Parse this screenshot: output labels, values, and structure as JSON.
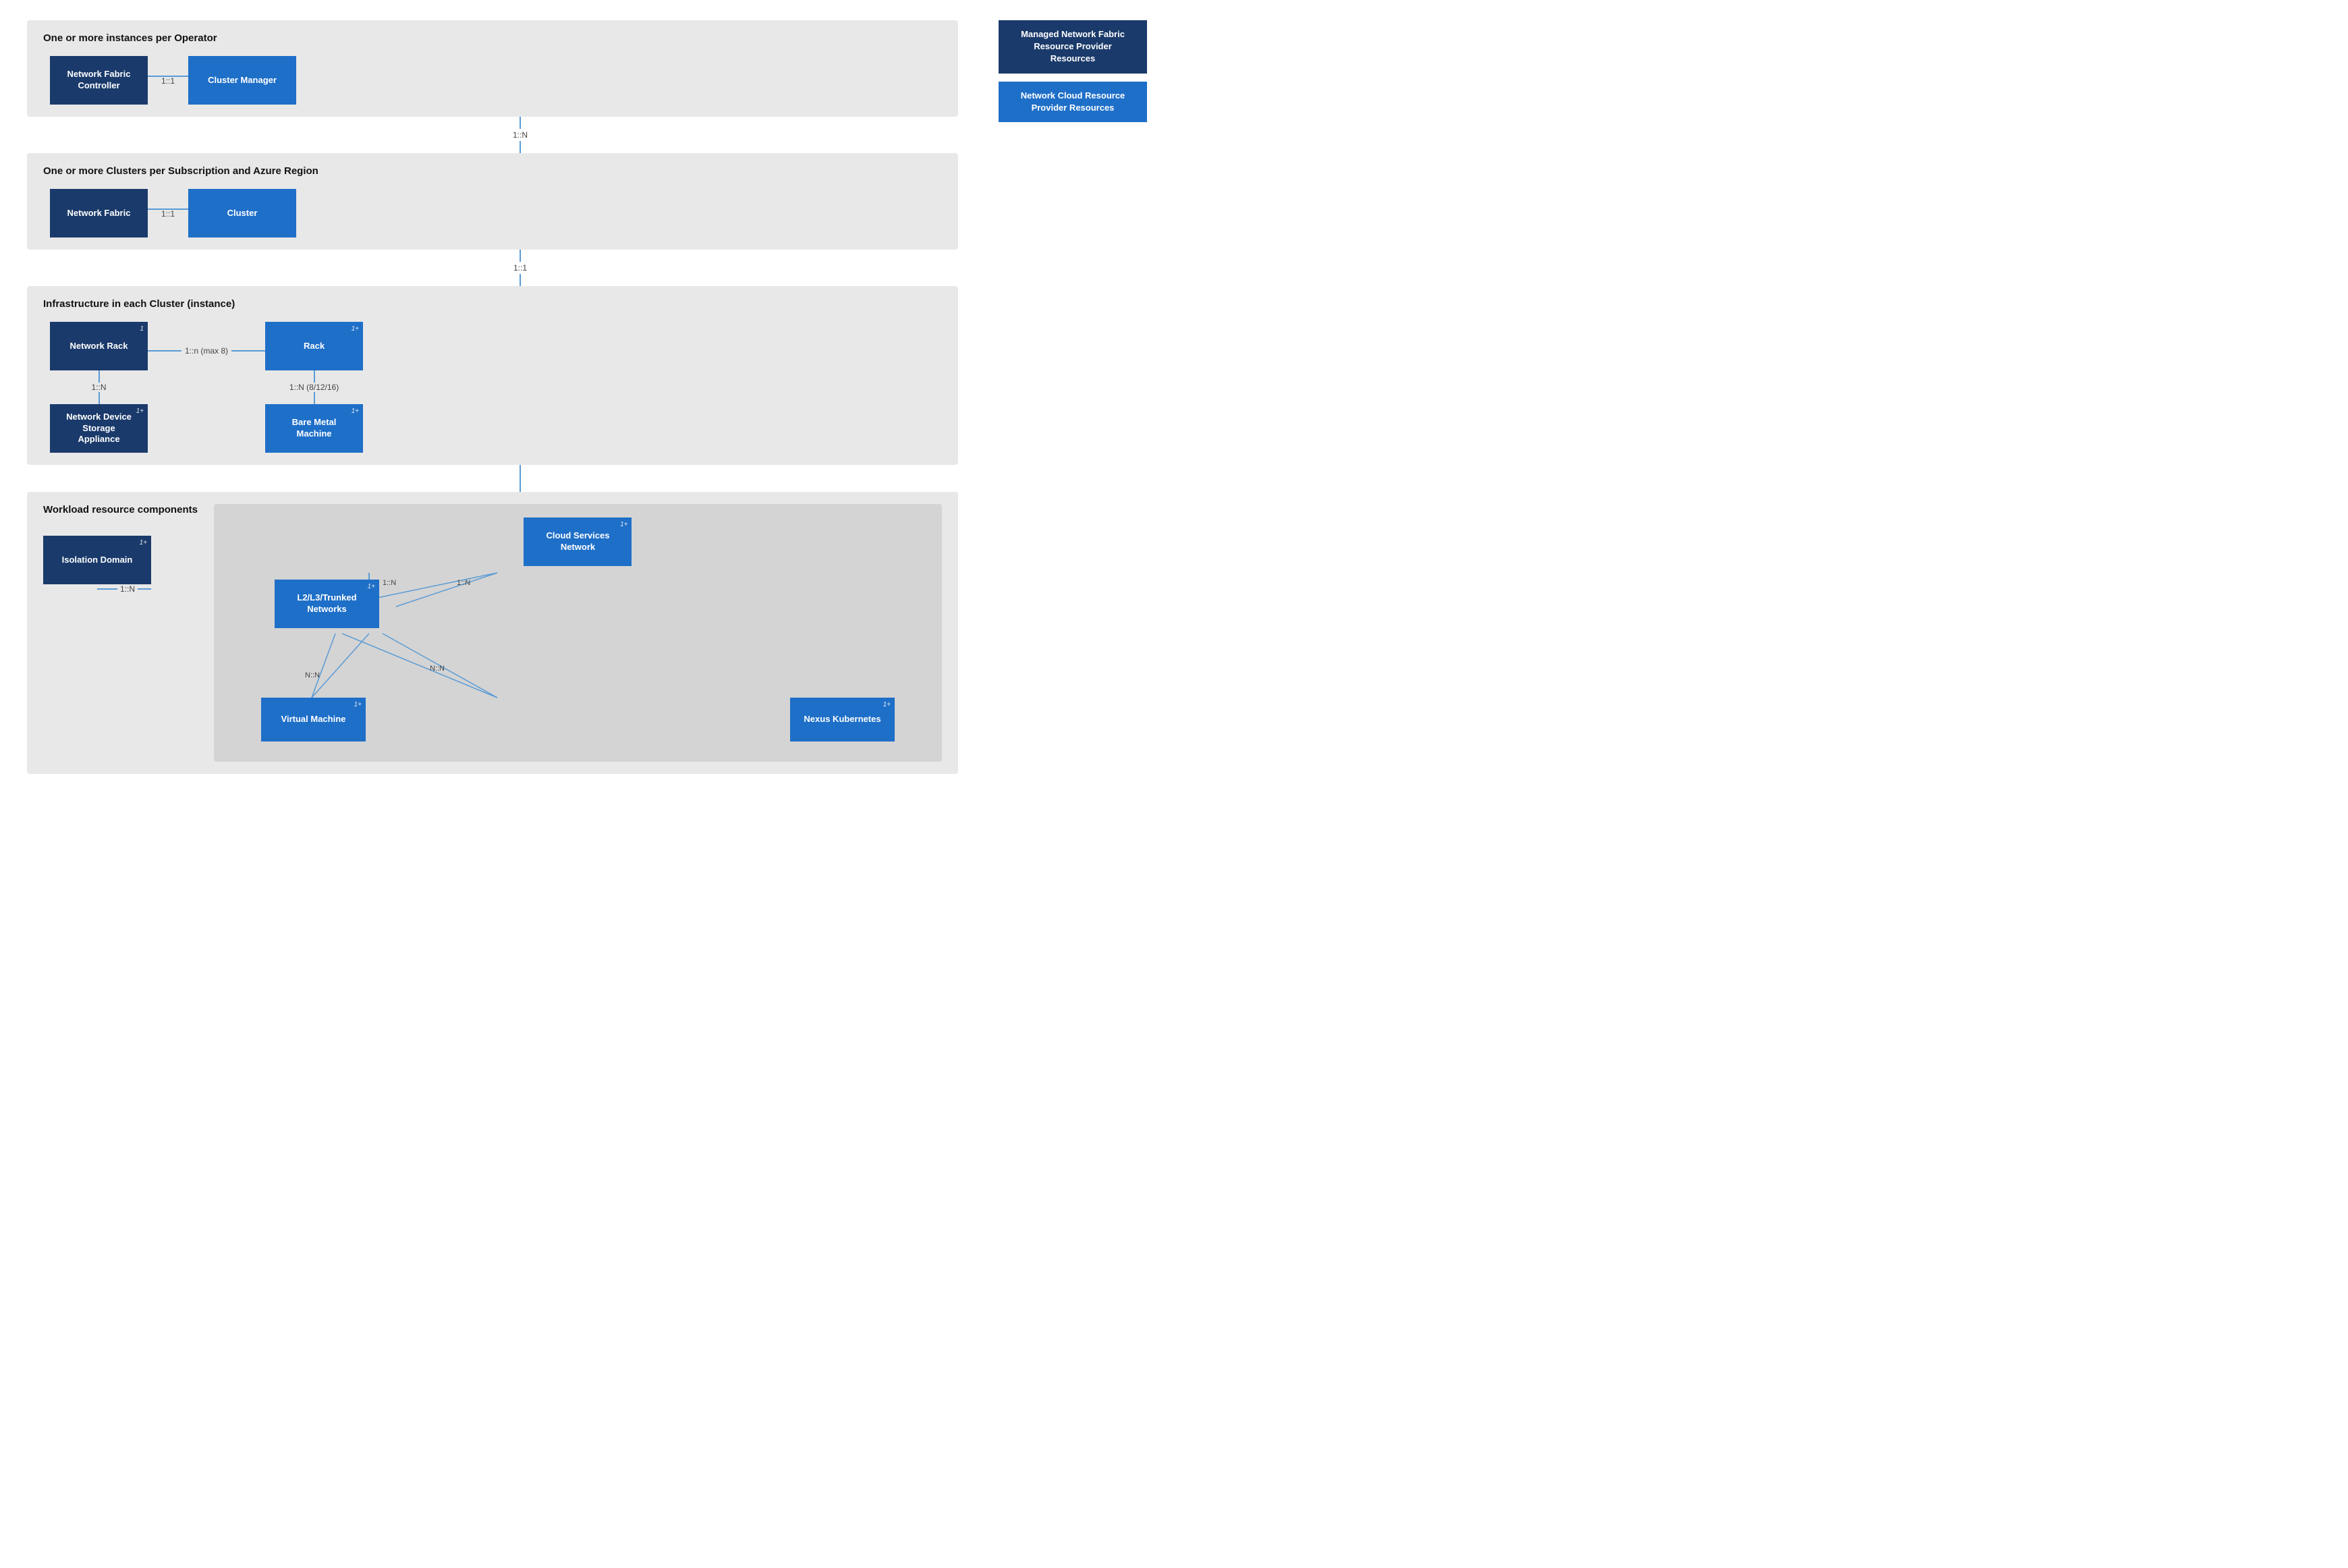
{
  "legend": {
    "item1": "Managed Network Fabric Resource Provider Resources",
    "item2": "Network Cloud Resource Provider Resources"
  },
  "section1": {
    "title": "One or more instances per Operator",
    "nodes": {
      "left": "Network Fabric Controller",
      "right": "Cluster Manager"
    },
    "connector": "1::1",
    "below_connector": "1::N"
  },
  "section2": {
    "title": "One or more Clusters per Subscription and Azure Region",
    "nodes": {
      "left": "Network Fabric",
      "right": "Cluster"
    },
    "connector": "1::1",
    "below_connector": "1::1"
  },
  "section3": {
    "title": "Infrastructure in each Cluster (instance)",
    "left_top": "Network Rack",
    "left_top_badge": "1",
    "left_connector": "1::N",
    "left_bottom": "Network Device Storage Appliance",
    "left_bottom_badge": "1+",
    "right_top": "Rack",
    "right_top_badge": "1+",
    "right_connector": "1::N (8/12/16)",
    "right_bottom": "Bare Metal Machine",
    "right_bottom_badge": "1+",
    "horiz_connector": "1::n (max 8)"
  },
  "section4": {
    "title": "Workload resource components",
    "isolation_domain": "Isolation Domain",
    "isolation_badge": "1+",
    "isolation_connector": "1::N",
    "cloud_services": "Cloud Services Network",
    "cloud_badge": "1+",
    "l2l3": "L2/L3/Trunked Networks",
    "l2l3_badge": "1+",
    "l2l3_connector_left": "1::N",
    "l2l3_connector_right": "1::N",
    "virtual_machine": "Virtual Machine",
    "vm_badge": "1+",
    "nexus": "Nexus Kubernetes",
    "nexus_badge": "1+",
    "nn_label1": "N::N",
    "nn_label2": "N::N"
  }
}
